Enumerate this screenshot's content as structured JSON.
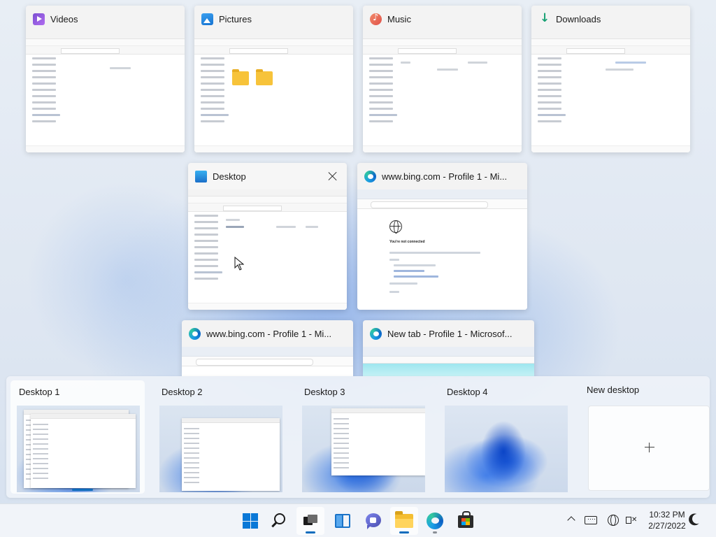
{
  "task_view": {
    "windows": [
      {
        "title": "Videos",
        "icon": "videos-icon"
      },
      {
        "title": "Pictures",
        "icon": "pictures-icon"
      },
      {
        "title": "Music",
        "icon": "music-icon"
      },
      {
        "title": "Downloads",
        "icon": "downloads-icon"
      },
      {
        "title": "Desktop",
        "icon": "desktop-icon"
      },
      {
        "title": "www.bing.com - Profile 1 - Mi...",
        "icon": "edge-icon"
      },
      {
        "title": "www.bing.com - Profile 1 - Mi...",
        "icon": "edge-icon"
      },
      {
        "title": "New tab - Profile 1 - Microsof...",
        "icon": "edge-icon"
      }
    ],
    "bing_error": "You're not connected"
  },
  "desktops": [
    {
      "label": "Desktop 1",
      "active": true
    },
    {
      "label": "Desktop 2",
      "active": false
    },
    {
      "label": "Desktop 3",
      "active": false
    },
    {
      "label": "Desktop 4",
      "active": false
    }
  ],
  "new_desktop_label": "New desktop",
  "taskbar": {
    "apps": [
      "start",
      "search",
      "task-view",
      "widgets",
      "chat",
      "file-explorer",
      "edge",
      "store"
    ],
    "time": "10:32 PM",
    "date": "2/27/2022"
  },
  "colors": {
    "accent": "#0f6cbd",
    "windows_blue": "#0a78d7",
    "folder_yellow": "#f4be32"
  }
}
